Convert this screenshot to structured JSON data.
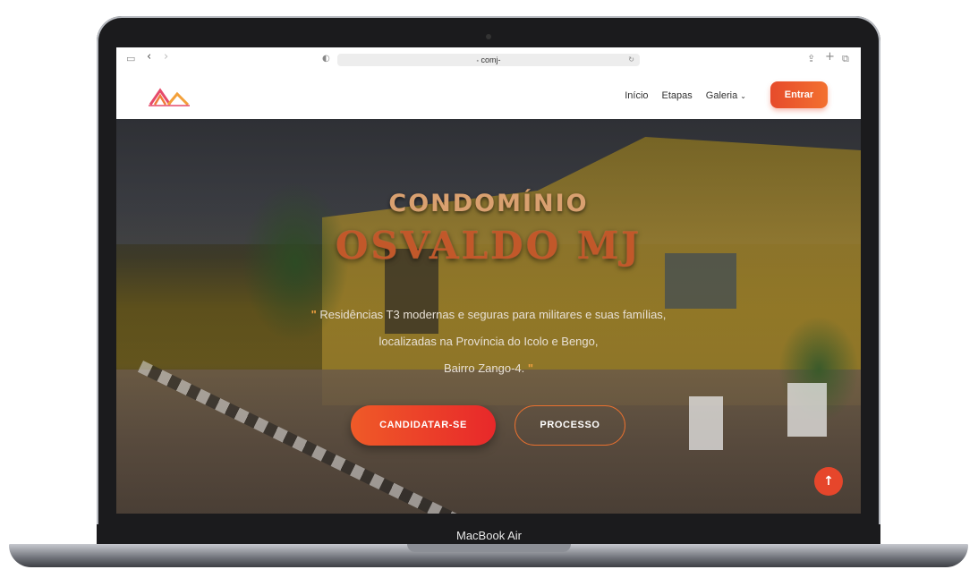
{
  "device": {
    "label": "MacBook Air"
  },
  "browser": {
    "url": "comj-",
    "lock_icon": "lock-icon",
    "icons": [
      "sidebar-icon",
      "back-icon",
      "forward-icon",
      "shield-icon",
      "reload-icon",
      "share-icon",
      "new-tab-icon",
      "tabs-icon"
    ]
  },
  "nav": {
    "links": [
      {
        "label": "Início"
      },
      {
        "label": "Etapas"
      },
      {
        "label": "Galeria"
      }
    ],
    "entrar_label": "Entrar"
  },
  "hero": {
    "title_line1": "CONDOMÍNIO",
    "title_line2": "OSVALDO MJ",
    "quote_open": "\"",
    "quote_close": "\"",
    "desc_line1": "Residências T3 modernas e seguras para militares e suas famílias,",
    "desc_line2": "localizadas na Província do Icolo e Bengo,",
    "desc_line3": "Bairro Zango-4.",
    "btn_primary": "CANDIDATAR-SE",
    "btn_secondary": "PROCESSO"
  },
  "colors": {
    "accent": "#e6462b",
    "accent_light": "#f3702f"
  }
}
